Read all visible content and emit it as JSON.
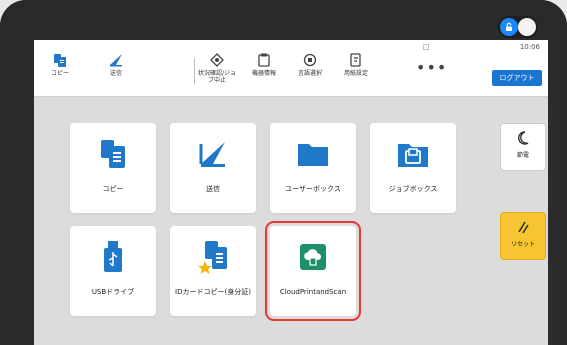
{
  "status": {
    "time": "10:06",
    "network": "□"
  },
  "toolbar": {
    "items": [
      {
        "label": "コピー",
        "icon": "copy-icon"
      },
      {
        "label": "送信",
        "icon": "send-icon"
      },
      {
        "label": "状況確認/ジョブ中止",
        "icon": "status-job-cancel-icon"
      },
      {
        "label": "機器情報",
        "icon": "device-info-icon"
      },
      {
        "label": "言語選択",
        "icon": "language-icon"
      },
      {
        "label": "用紙設定",
        "icon": "paper-settings-icon"
      }
    ],
    "more": "•••",
    "logout": "ログアウト"
  },
  "tiles": [
    {
      "label": "コピー",
      "icon": "copy-icon"
    },
    {
      "label": "送信",
      "icon": "send-icon"
    },
    {
      "label": "ユーザーボックス",
      "icon": "folder-icon"
    },
    {
      "label": "ジョブボックス",
      "icon": "job-box-icon"
    },
    {
      "label": "USBドライブ",
      "icon": "usb-icon"
    },
    {
      "label": "IDカードコピー(身分証)",
      "icon": "id-card-copy-icon"
    },
    {
      "label": "CloudPrintandScan",
      "icon": "cloud-print-scan-icon"
    }
  ],
  "side": {
    "sleep": "節電",
    "reset": "リセット"
  },
  "colors": {
    "accent_blue": "#1a76d2",
    "tile_blue": "#1f78c8",
    "cloud_green": "#1e8f6a",
    "selection_red": "#e53935",
    "reset_yellow": "#f7c531"
  }
}
